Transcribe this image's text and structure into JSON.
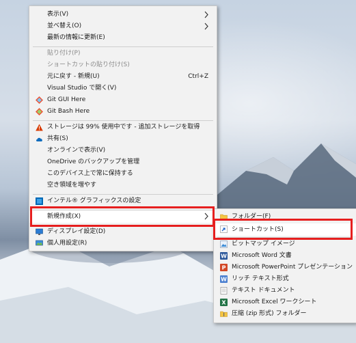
{
  "context_menu": {
    "view": "表示(V)",
    "sort_by": "並べ替え(O)",
    "refresh": "最新の情報に更新(E)",
    "paste": "貼り付け(P)",
    "paste_shortcut": "ショートカットの貼り付け(S)",
    "undo_new": "元に戻す - 新規(U)",
    "undo_shortcut": "Ctrl+Z",
    "open_vs": "Visual Studio で開く(V)",
    "git_gui": "Git GUI Here",
    "git_bash": "Git Bash Here",
    "storage": "ストレージは 99% 使用中です - 追加ストレージを取得",
    "share": "共有(S)",
    "view_online": "オンラインで表示(V)",
    "onedrive_backup": "OneDrive のバックアップを管理",
    "always_keep": "このデバイス上で常に保持する",
    "free_space": "空き領域を増やす",
    "intel_graphics": "インテル® グラフィックスの設定",
    "new": "新規作成(X)",
    "display_settings": "ディスプレイ設定(D)",
    "personalize": "個人用設定(R)"
  },
  "submenu": {
    "folder": "フォルダー(F)",
    "shortcut": "ショートカット(S)",
    "bitmap": "ビットマップ イメージ",
    "word": "Microsoft Word 文書",
    "powerpoint": "Microsoft PowerPoint プレゼンテーション",
    "rtf": "リッチ テキスト形式",
    "text": "テキスト ドキュメント",
    "excel": "Microsoft Excel ワークシート",
    "zip": "圧縮 (zip 形式) フォルダー"
  },
  "colors": {
    "highlight_box": "#e61e1e",
    "menu_bg": "#f2f2f2"
  }
}
